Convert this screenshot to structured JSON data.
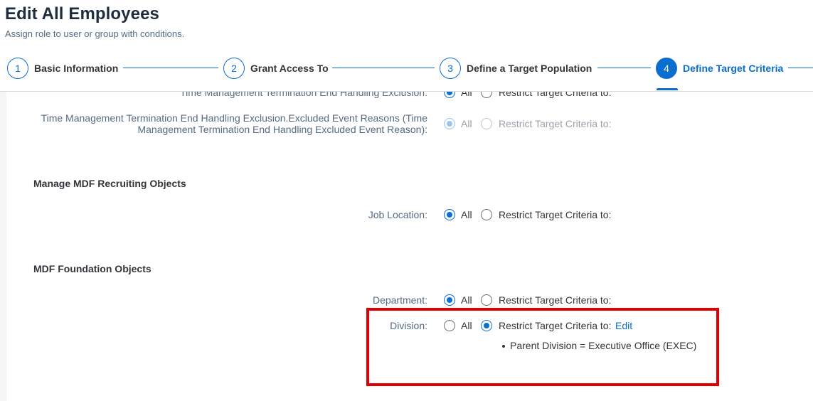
{
  "page": {
    "title": "Edit All Employees",
    "subtitle": "Assign role to user or group with conditions."
  },
  "wizard": {
    "steps": [
      {
        "number": "1",
        "label": "Basic Information"
      },
      {
        "number": "2",
        "label": "Grant Access To"
      },
      {
        "number": "3",
        "label": "Define a Target Population"
      },
      {
        "number": "4",
        "label": "Define Target Criteria"
      }
    ],
    "active_step": 4
  },
  "criteria": {
    "option_all": "All",
    "option_restrict": "Restrict Target Criteria to:",
    "edit_label": "Edit"
  },
  "rows": {
    "tm_exclusion": {
      "label": "Time Management Termination End Handling Exclusion:"
    },
    "tm_excluded_reasons": {
      "label_line1": "Time Management Termination End Handling Exclusion.Excluded Event Reasons (Time",
      "label_line2": "Management Termination End Handling Excluded Event Reason):"
    },
    "job_location": {
      "label": "Job Location:"
    },
    "department": {
      "label": "Department:"
    },
    "division": {
      "label": "Division:",
      "criteria": [
        "Parent Division = Executive Office (EXEC)"
      ]
    }
  },
  "sections": {
    "recruiting": "Manage MDF Recruiting Objects",
    "foundation": "MDF Foundation Objects"
  },
  "colors": {
    "accent": "#0a6ed1",
    "highlight": "#e10000"
  }
}
